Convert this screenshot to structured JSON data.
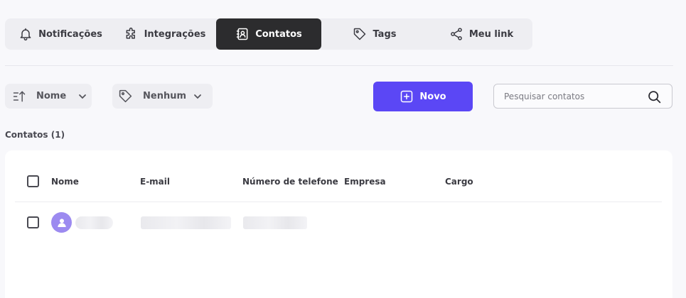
{
  "tabs": [
    {
      "label": "Notificações",
      "icon": "bell-icon",
      "active": false
    },
    {
      "label": "Integrações",
      "icon": "puzzle-icon",
      "active": false
    },
    {
      "label": "Contatos",
      "icon": "contacts-icon",
      "active": true
    },
    {
      "label": "Tags",
      "icon": "tag-icon",
      "active": false
    },
    {
      "label": "Meu link",
      "icon": "share-icon",
      "active": false
    }
  ],
  "toolbar": {
    "sort_label": "Nome",
    "tag_filter_label": "Nenhum",
    "new_button_label": "Novo",
    "search_placeholder": "Pesquisar contatos"
  },
  "contacts_count_label": "Contatos (1)",
  "table": {
    "columns": [
      "Nome",
      "E-mail",
      "Número de telefone",
      "Empresa",
      "Cargo"
    ]
  },
  "colors": {
    "accent": "#5b47f5",
    "active_tab": "#2c2c2e",
    "avatar": "#9c8af0"
  }
}
